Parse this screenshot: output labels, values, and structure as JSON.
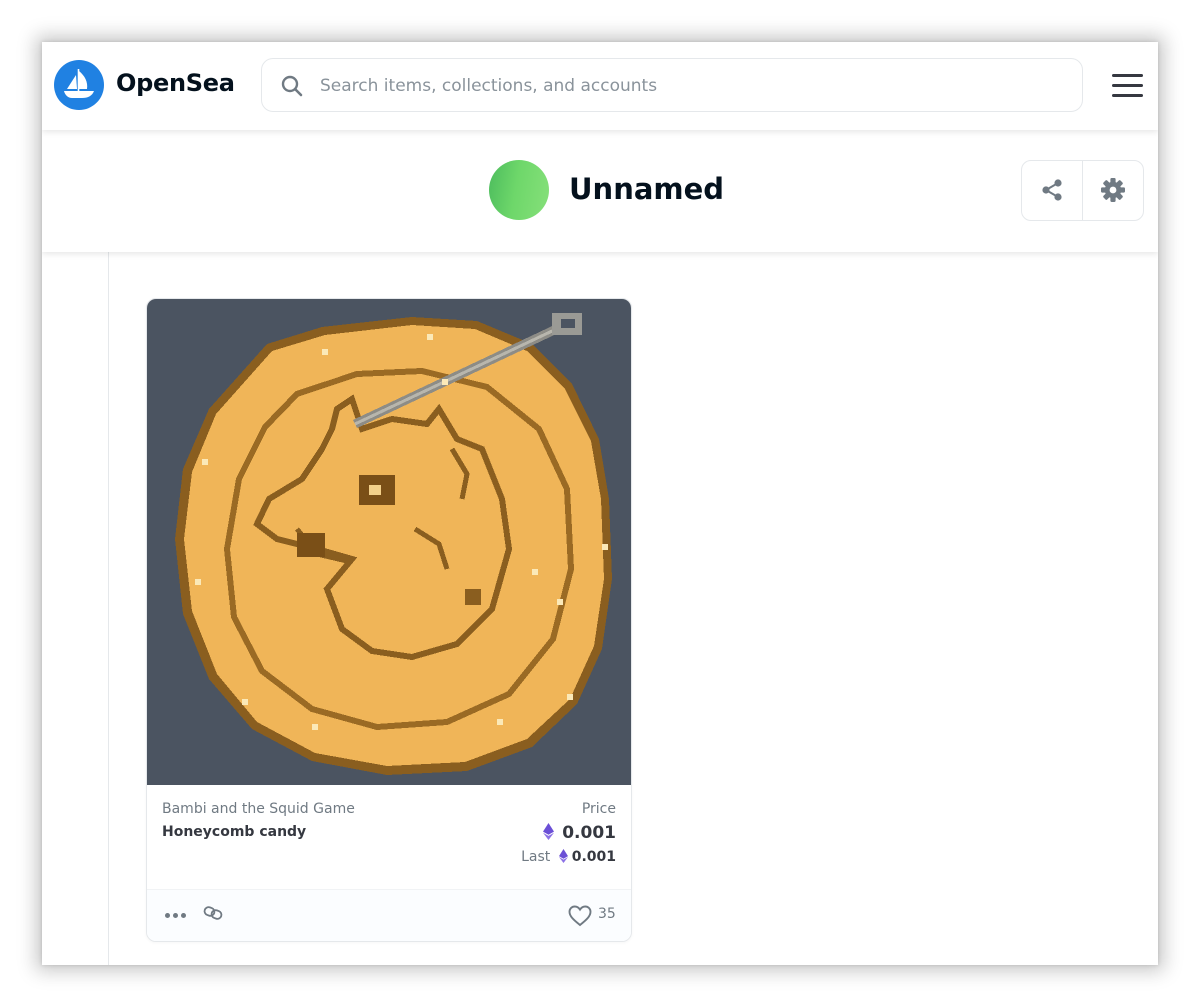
{
  "header": {
    "brand": "OpenSea",
    "search_placeholder": "Search items, collections, and accounts"
  },
  "profile": {
    "name": "Unnamed"
  },
  "card": {
    "collection": "Bambi and the Squid Game",
    "name": "Honeycomb candy",
    "price_label": "Price",
    "price": "0.001",
    "last_label": "Last",
    "last_price": "0.001",
    "likes": "35"
  },
  "colors": {
    "brand_blue": "#2081e2",
    "artwork_background": "#4b5461",
    "candy": "#f0b558",
    "eth_purple": "#6b4fd6"
  },
  "icons": [
    "opensea-logo-icon",
    "search-icon",
    "hamburger-menu-icon",
    "share-icon",
    "gear-icon",
    "ethereum-icon",
    "more-icon",
    "chain-link-icon",
    "heart-icon"
  ]
}
